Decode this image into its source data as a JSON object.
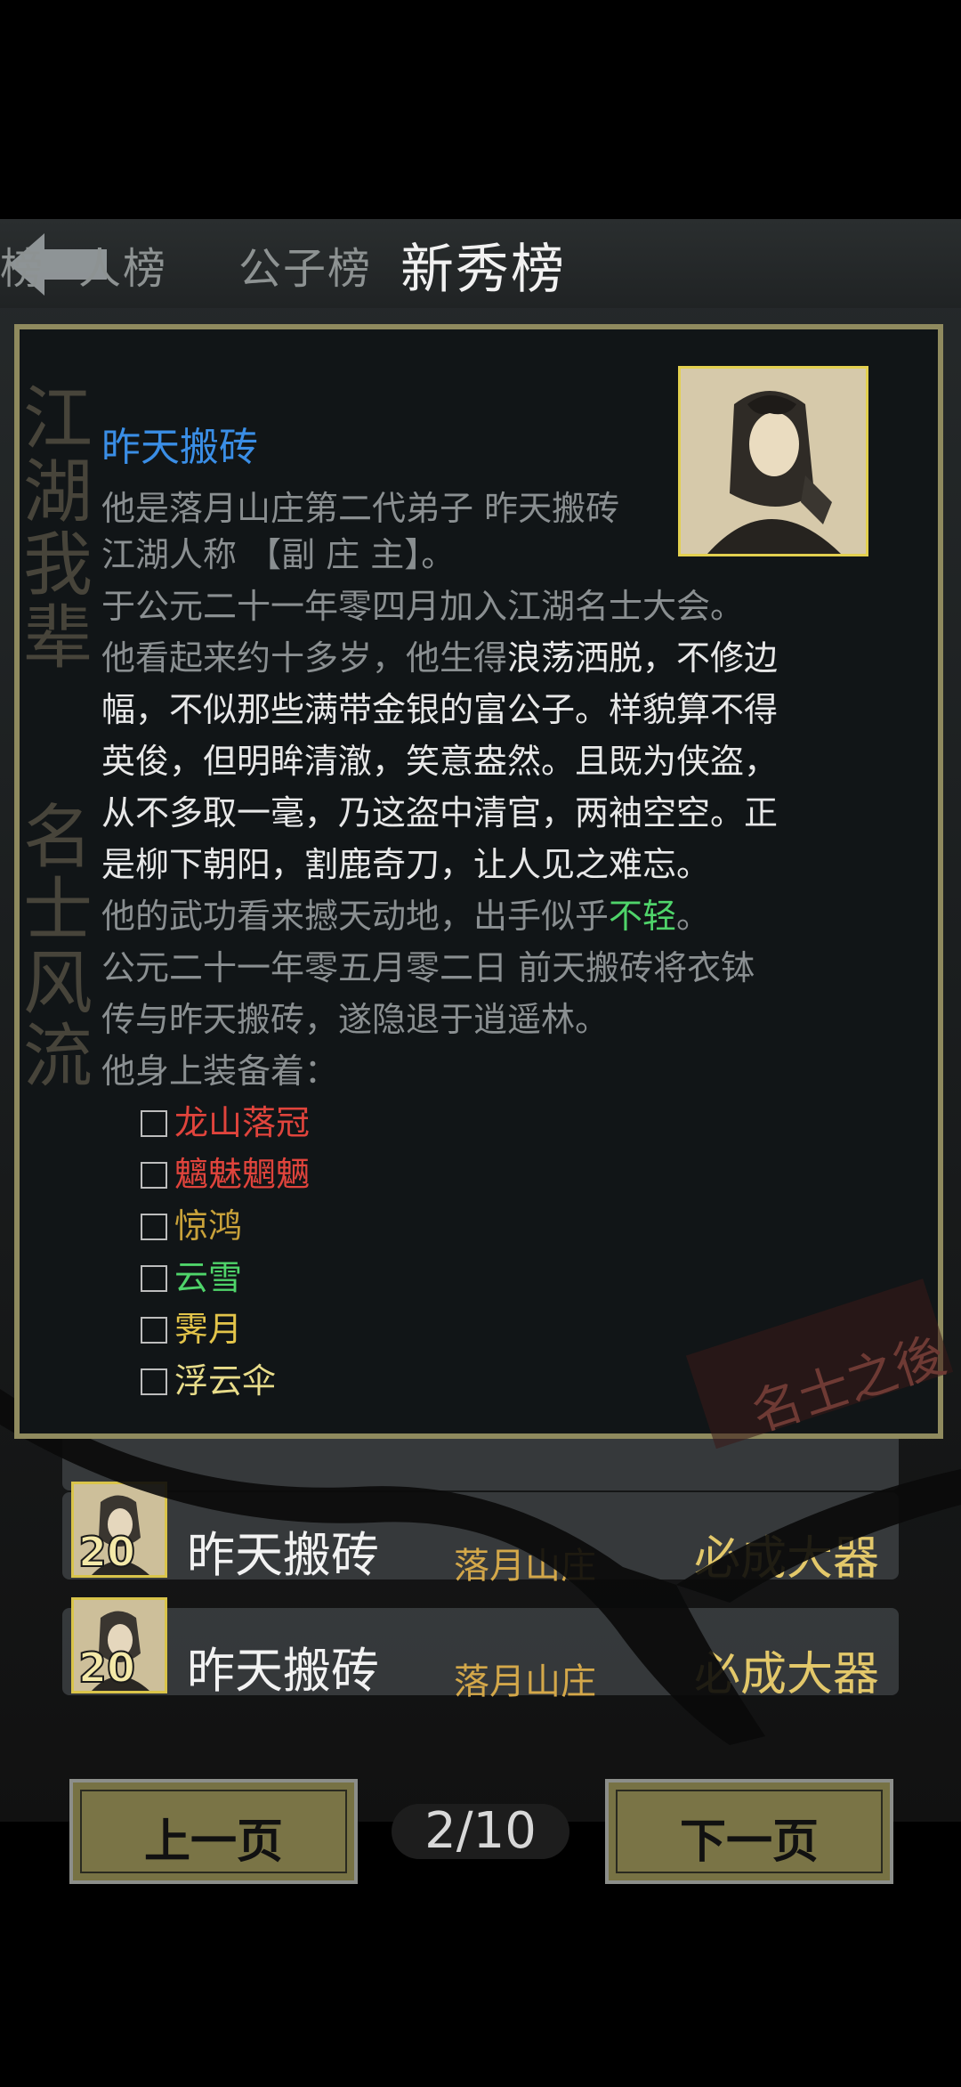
{
  "tabs": [
    {
      "label": "榜"
    },
    {
      "label": "人榜"
    },
    {
      "label": "公子榜"
    },
    {
      "label": "新秀榜"
    }
  ],
  "calligraphy": {
    "left_top": "江湖我辈",
    "left_bottom": "名士风流",
    "stamp": "名士之後"
  },
  "hero": {
    "name": "昨天搬砖",
    "lines": [
      "他是落月山庄第二代弟子 昨天搬砖",
      "江湖人称 【副 庄 主】。",
      "于公元二十一年零四月加入江湖名士大会。"
    ],
    "desc_prefix": "他看起来约十多岁，他生得",
    "desc_1": "浪荡洒脱，不修边",
    "desc_2": "幅，不似那些满带金银的富公子。样貌算不得",
    "desc_3": "英俊，但明眸清澈，笑意盎然。且既为侠盗，",
    "desc_4": "从不多取一毫，乃这盗中清官，两袖空空。正",
    "desc_5": "是柳下朝阳，割鹿奇刀，让人见之难忘。",
    "kungfu_prefix": "他的武功看来撼天动地，出手似乎",
    "kungfu_value": "不轻",
    "kungfu_suffix": "。",
    "history_1": "公元二十一年零五月零二日 前天搬砖将衣钵",
    "history_2": "传与昨天搬砖，遂隐退于逍遥林。",
    "equip_title": "他身上装备着：",
    "equipment": [
      {
        "name": "龙山落冠",
        "color": "#e0443c"
      },
      {
        "name": "魑魅魍魉",
        "color": "#e0443c"
      },
      {
        "name": "惊鸿",
        "color": "#c9a23a"
      },
      {
        "name": "云雪",
        "color": "#4fd46a"
      },
      {
        "name": "霁月",
        "color": "#e3c44a"
      },
      {
        "name": "浮云伞",
        "color": "#e8dc8a"
      }
    ]
  },
  "rows": [
    {
      "level": "20",
      "name": "昨天搬砖",
      "sect": "落月山庄",
      "title": "必成大器"
    },
    {
      "level": "20",
      "name": "昨天搬砖",
      "sect": "落月山庄",
      "title": "必成大器"
    }
  ],
  "pagination": {
    "prev": "上一页",
    "next": "下一页",
    "page": "2/10"
  }
}
